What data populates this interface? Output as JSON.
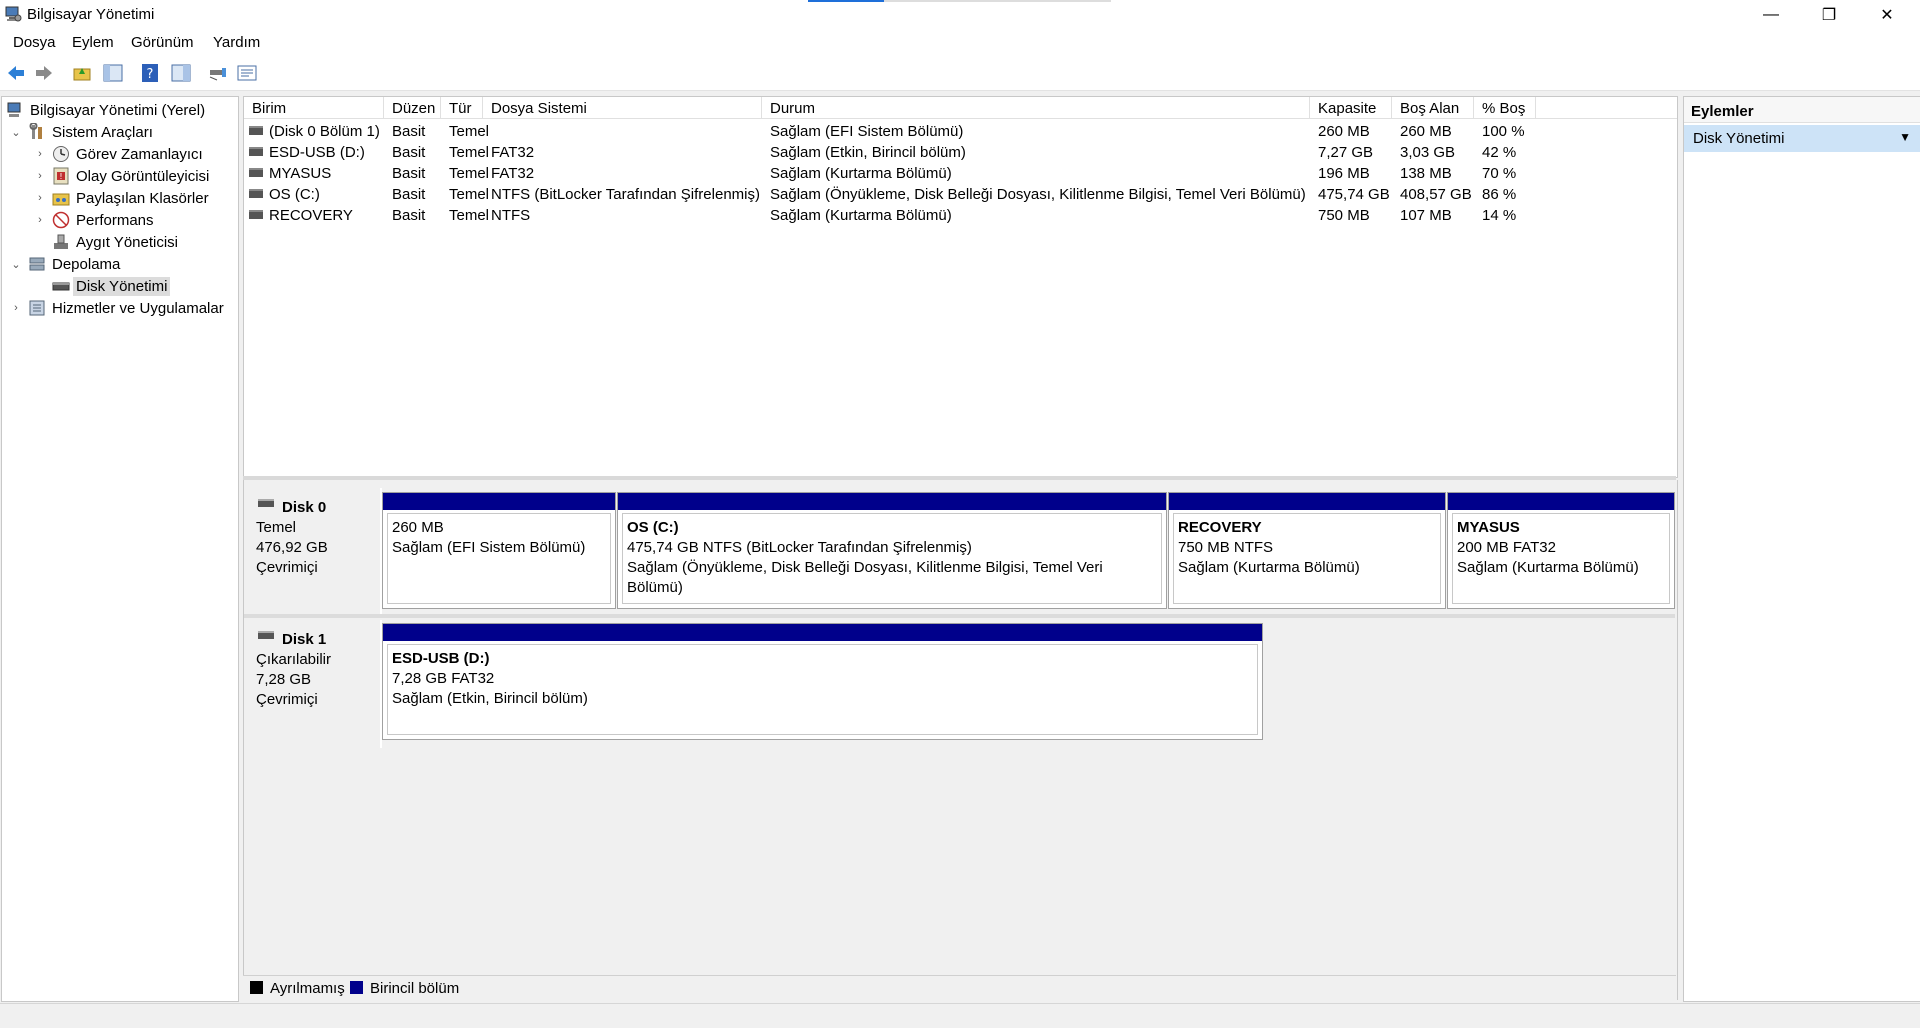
{
  "window": {
    "title": "Bilgisayar Yönetimi",
    "controls": {
      "minimize": "—",
      "restore": "❐",
      "close": "✕"
    },
    "loading_progress": 0.25
  },
  "menu": [
    "Dosya",
    "Eylem",
    "Görünüm",
    "Yardım"
  ],
  "toolbar": [
    "back-icon",
    "forward-icon",
    "up-folder-icon",
    "show-hide-tree-icon",
    "help-icon",
    "show-hide-action-pane-icon",
    "connect-icon",
    "properties-icon"
  ],
  "tree": {
    "root": "Bilgisayar Yönetimi (Yerel)",
    "system_tools": "Sistem Araçları",
    "task_scheduler": "Görev Zamanlayıcı",
    "event_viewer": "Olay Görüntüleyicisi",
    "shared_folders": "Paylaşılan Klasörler",
    "performance": "Performans",
    "device_manager": "Aygıt Yöneticisi",
    "storage": "Depolama",
    "disk_management": "Disk Yönetimi",
    "services_apps": "Hizmetler ve Uygulamalar"
  },
  "columns": [
    "Birim",
    "Düzen",
    "Tür",
    "Dosya Sistemi",
    "Durum",
    "Kapasite",
    "Boş Alan",
    "% Boş"
  ],
  "volumes": [
    [
      "(Disk 0 Bölüm 1)",
      "Basit",
      "Temel",
      "",
      "Sağlam (EFI Sistem Bölümü)",
      "260 MB",
      "260 MB",
      "100 %"
    ],
    [
      "ESD-USB (D:)",
      "Basit",
      "Temel",
      "FAT32",
      "Sağlam (Etkin, Birincil bölüm)",
      "7,27 GB",
      "3,03 GB",
      "42 %"
    ],
    [
      "MYASUS",
      "Basit",
      "Temel",
      "FAT32",
      "Sağlam (Kurtarma Bölümü)",
      "196 MB",
      "138 MB",
      "70 %"
    ],
    [
      "OS (C:)",
      "Basit",
      "Temel",
      "NTFS (BitLocker Tarafından Şifrelenmiş)",
      "Sağlam (Önyükleme, Disk Belleği Dosyası, Kilitlenme Bilgisi, Temel Veri Bölümü)",
      "475,74 GB",
      "408,57 GB",
      "86 %"
    ],
    [
      "RECOVERY",
      "Basit",
      "Temel",
      "NTFS",
      "Sağlam (Kurtarma Bölümü)",
      "750 MB",
      "107 MB",
      "14 %"
    ]
  ],
  "disk0": {
    "name": "Disk 0",
    "type": "Temel",
    "size": "476,92 GB",
    "state": "Çevrimiçi",
    "p1": {
      "title": "",
      "line1": "260 MB",
      "line2": "Sağlam (EFI Sistem Bölümü)"
    },
    "p2": {
      "title": "OS  (C:)",
      "line1": "475,74 GB NTFS (BitLocker Tarafından Şifrelenmiş)",
      "line2": "Sağlam (Önyükleme, Disk Belleği Dosyası, Kilitlenme Bilgisi, Temel Veri Bölümü)"
    },
    "p3": {
      "title": "RECOVERY",
      "line1": "750 MB NTFS",
      "line2": "Sağlam (Kurtarma Bölümü)"
    },
    "p4": {
      "title": "MYASUS",
      "line1": "200 MB FAT32",
      "line2": "Sağlam (Kurtarma Bölümü)"
    }
  },
  "disk1": {
    "name": "Disk 1",
    "type": "Çıkarılabilir",
    "size": "7,28 GB",
    "state": "Çevrimiçi",
    "p1": {
      "title": "ESD-USB  (D:)",
      "line1": "7,28 GB FAT32",
      "line2": "Sağlam (Etkin, Birincil bölüm)"
    }
  },
  "legend": {
    "unallocated": "Ayrılmamış",
    "primary": "Birincil bölüm",
    "unallocated_color": "#000000",
    "primary_color": "#00008b"
  },
  "actions": {
    "title": "Eylemler",
    "item": "Disk Yönetimi"
  }
}
